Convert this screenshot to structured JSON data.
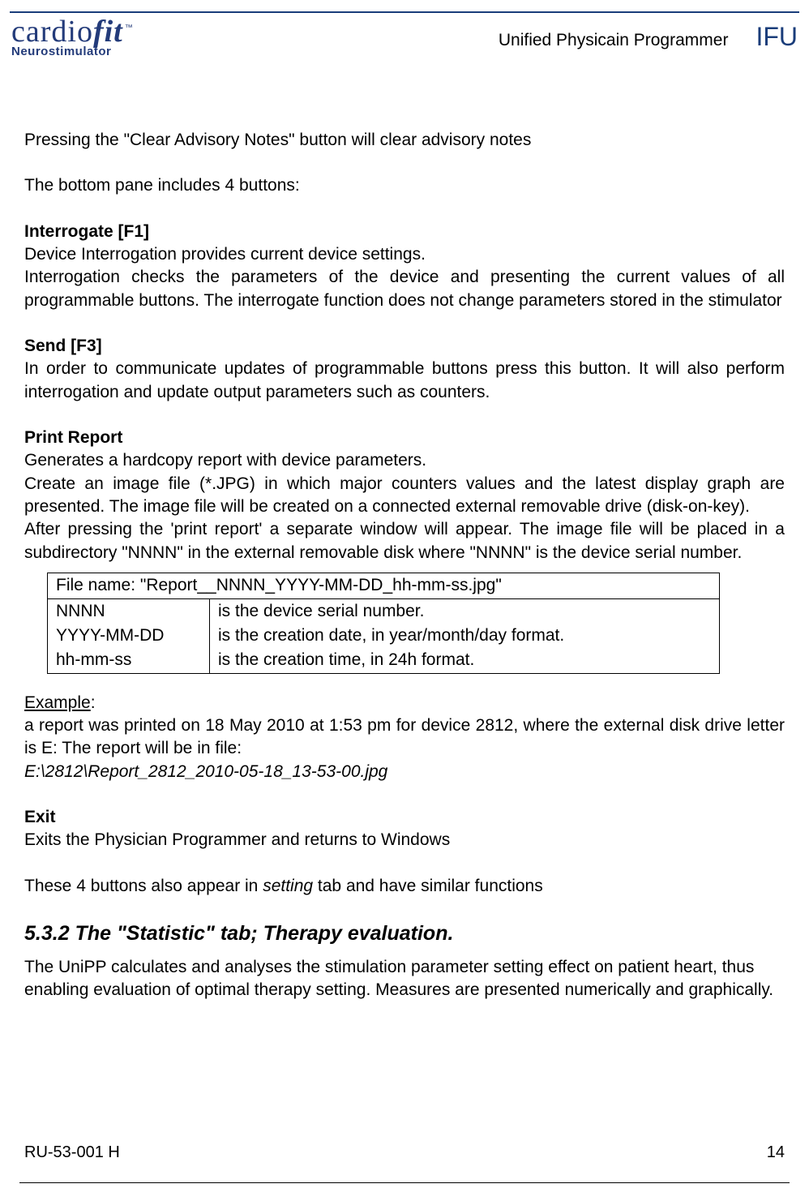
{
  "header": {
    "logo_main_cardio": "cardio",
    "logo_main_fit": "fit",
    "logo_tm": "™",
    "logo_sub": "Neurostimulator",
    "title": "Unified Physicain Programmer",
    "ifu": "IFU"
  },
  "intro": {
    "line1": "Pressing the \"Clear Advisory Notes\" button will clear advisory notes",
    "line2": "The bottom pane includes 4 buttons:"
  },
  "interrogate": {
    "heading": "Interrogate [F1]",
    "line1": "Device Interrogation provides current device settings.",
    "line2": "Interrogation checks the parameters of the device and presenting the current values of all programmable buttons. The interrogate function does not change parameters stored in the stimulator"
  },
  "send": {
    "heading": "Send [F3]",
    "line1": "In order to communicate updates of programmable buttons press this button. It will also perform interrogation and update output parameters such as counters."
  },
  "print": {
    "heading": "Print Report",
    "line1": "Generates a hardcopy report with device parameters.",
    "line2": "Create an image file (*.JPG) in which major counters values and the latest display graph are presented. The image file will be created on a connected external removable drive (disk-on-key).",
    "line3": "After pressing the 'print report' a separate window will appear. The image file will be placed in a subdirectory \"NNNN\" in the external removable disk where \"NNNN\" is the device serial number."
  },
  "table": {
    "row0": "File name: \"Report__NNNN_YYYY-MM-DD_hh-mm-ss.jpg\"",
    "r1c1": "NNNN",
    "r1c2": "is the device serial number.",
    "r2c1": "YYYY-MM-DD",
    "r2c2": "is the creation date, in year/month/day format.",
    "r3c1": "hh-mm-ss",
    "r3c2": "is the creation time, in 24h format."
  },
  "example": {
    "label": "Example",
    "colon": ":",
    "line1": "a report was printed on 18 May 2010 at 1:53 pm for device 2812, where the external disk drive letter is E: The report will be in file:",
    "line2": "E:\\2812\\Report_2812_2010-05-18_13-53-00.jpg"
  },
  "exit": {
    "heading": "Exit",
    "line1": "Exits the Physician Programmer and returns to Windows"
  },
  "outro": {
    "line_p1": "These 4 buttons also appear in ",
    "line_it": "setting",
    "line_p2": " tab and have similar functions"
  },
  "section532": {
    "heading": "5.3.2 The \"Statistic\" tab; Therapy evaluation.",
    "body": "The UniPP calculates and analyses the stimulation parameter setting effect on patient heart, thus enabling evaluation of optimal therapy setting. Measures are presented numerically and graphically."
  },
  "footer": {
    "docid": "RU-53-001 H",
    "page": "14"
  }
}
